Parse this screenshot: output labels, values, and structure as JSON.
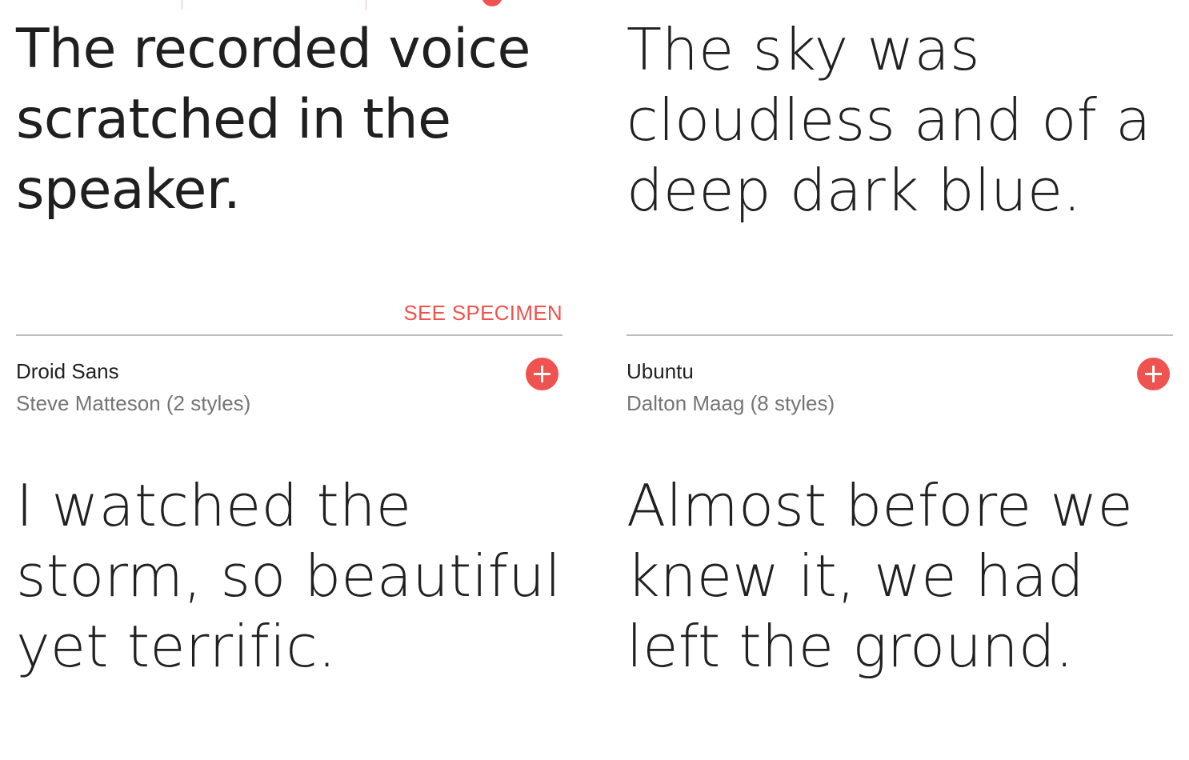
{
  "cards": [
    {
      "sample_text": "The recorded voice scratched in the speaker.",
      "action_label": "SEE SPECIMEN"
    },
    {
      "sample_text": "The sky was cloudless and of a deep dark blue."
    },
    {
      "font_name": "Droid Sans",
      "author_styles": "Steve Matteson (2 styles)",
      "sample_text": "I watched the storm, so beautiful yet terrific."
    },
    {
      "font_name": "Ubuntu",
      "author_styles": "Dalton Maag (8 styles)",
      "sample_text": "Almost before we knew it, we had left the ground."
    }
  ],
  "icons": {
    "add": "plus-circle-icon"
  },
  "colors": {
    "accent": "#ef5350",
    "divider": "#bdbdbd",
    "text_primary": "#212121",
    "text_secondary": "#757575"
  }
}
